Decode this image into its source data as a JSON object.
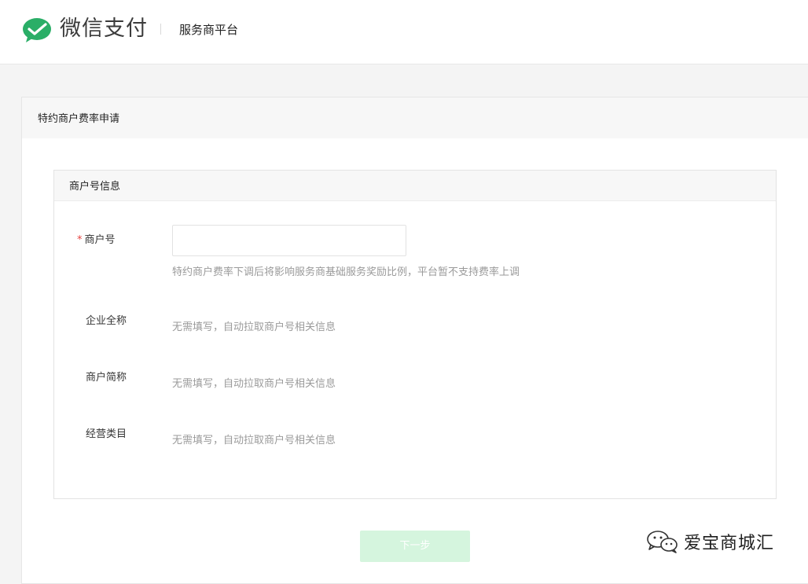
{
  "header": {
    "brand": "微信支付",
    "platform": "服务商平台",
    "brand_color": "#2aae67"
  },
  "card": {
    "title": "特约商户费率申请"
  },
  "panel": {
    "title": "商户号信息",
    "merchant_id": {
      "required_mark": "*",
      "label": "商户号",
      "value": "",
      "placeholder": "",
      "hint": "特约商户费率下调后将影响服务商基础服务奖励比例，平台暂不支持费率上调"
    },
    "company_name": {
      "label": "企业全称",
      "hint": "无需填写，自动拉取商户号相关信息"
    },
    "short_name": {
      "label": "商户简称",
      "hint": "无需填写，自动拉取商户号相关信息"
    },
    "category": {
      "label": "经营类目",
      "hint": "无需填写，自动拉取商户号相关信息"
    }
  },
  "actions": {
    "next_label": "下一步",
    "next_bg": "#d5f5de"
  },
  "watermark": {
    "text": "爱宝商城汇",
    "icon": "wechat-bubbles-icon"
  }
}
